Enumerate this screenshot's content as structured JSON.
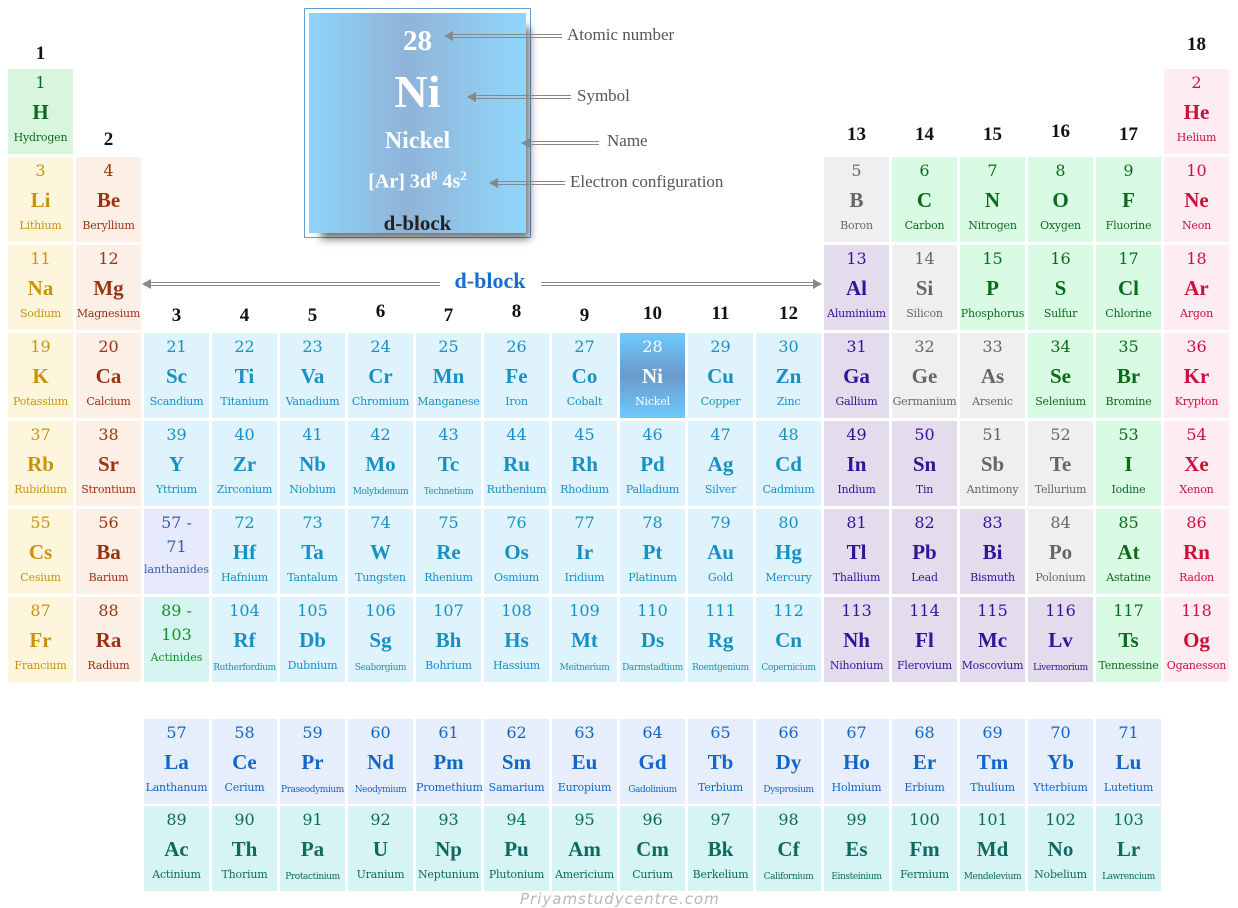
{
  "legend": {
    "atomic_number": "28",
    "symbol": "Ni",
    "name": "Nickel",
    "config_base": "[Ar] 3d",
    "config_sup1": "8",
    "config_mid": " 4s",
    "config_sup2": "2",
    "block": "d-block",
    "annotations": {
      "atomic_number": "Atomic number",
      "symbol": "Symbol",
      "name": "Name",
      "electron_configuration": "Electron configuration"
    }
  },
  "dblock_span_label": "d-block",
  "groups": [
    "1",
    "2",
    "3",
    "4",
    "5",
    "6",
    "7",
    "8",
    "9",
    "10",
    "11",
    "12",
    "13",
    "14",
    "15",
    "16",
    "17",
    "18"
  ],
  "highlighted_element": "Ni",
  "elements": [
    {
      "n": "1",
      "s": "H",
      "name": "Hydrogen",
      "col": 1,
      "row": 1,
      "cat": "nonmetal"
    },
    {
      "n": "2",
      "s": "He",
      "name": "Helium",
      "col": 18,
      "row": 1,
      "cat": "noble"
    },
    {
      "n": "3",
      "s": "Li",
      "name": "Lithium",
      "col": 1,
      "row": 2,
      "cat": "alkali"
    },
    {
      "n": "4",
      "s": "Be",
      "name": "Beryllium",
      "col": 2,
      "row": 2,
      "cat": "alkearth"
    },
    {
      "n": "5",
      "s": "B",
      "name": "Boron",
      "col": 13,
      "row": 2,
      "cat": "metalloid"
    },
    {
      "n": "6",
      "s": "C",
      "name": "Carbon",
      "col": 14,
      "row": 2,
      "cat": "nonmetal2"
    },
    {
      "n": "7",
      "s": "N",
      "name": "Nitrogen",
      "col": 15,
      "row": 2,
      "cat": "nonmetal2"
    },
    {
      "n": "8",
      "s": "O",
      "name": "Oxygen",
      "col": 16,
      "row": 2,
      "cat": "nonmetal2"
    },
    {
      "n": "9",
      "s": "F",
      "name": "Fluorine",
      "col": 17,
      "row": 2,
      "cat": "nonmetal2"
    },
    {
      "n": "10",
      "s": "Ne",
      "name": "Neon",
      "col": 18,
      "row": 2,
      "cat": "noble"
    },
    {
      "n": "11",
      "s": "Na",
      "name": "Sodium",
      "col": 1,
      "row": 3,
      "cat": "alkali"
    },
    {
      "n": "12",
      "s": "Mg",
      "name": "Magnesium",
      "col": 2,
      "row": 3,
      "cat": "alkearth"
    },
    {
      "n": "13",
      "s": "Al",
      "name": "Aluminium",
      "col": 13,
      "row": 3,
      "cat": "post"
    },
    {
      "n": "14",
      "s": "Si",
      "name": "Silicon",
      "col": 14,
      "row": 3,
      "cat": "metalloid"
    },
    {
      "n": "15",
      "s": "P",
      "name": "Phosphorus",
      "col": 15,
      "row": 3,
      "cat": "nonmetal2"
    },
    {
      "n": "16",
      "s": "S",
      "name": "Sulfur",
      "col": 16,
      "row": 3,
      "cat": "nonmetal2"
    },
    {
      "n": "17",
      "s": "Cl",
      "name": "Chlorine",
      "col": 17,
      "row": 3,
      "cat": "nonmetal2"
    },
    {
      "n": "18",
      "s": "Ar",
      "name": "Argon",
      "col": 18,
      "row": 3,
      "cat": "noble"
    },
    {
      "n": "19",
      "s": "K",
      "name": "Potassium",
      "col": 1,
      "row": 4,
      "cat": "alkali"
    },
    {
      "n": "20",
      "s": "Ca",
      "name": "Calcium",
      "col": 2,
      "row": 4,
      "cat": "alkearth"
    },
    {
      "n": "21",
      "s": "Sc",
      "name": "Scandium",
      "col": 3,
      "row": 4,
      "cat": "trans"
    },
    {
      "n": "22",
      "s": "Ti",
      "name": "Titanium",
      "col": 4,
      "row": 4,
      "cat": "trans"
    },
    {
      "n": "23",
      "s": "Va",
      "name": "Vanadium",
      "col": 5,
      "row": 4,
      "cat": "trans"
    },
    {
      "n": "24",
      "s": "Cr",
      "name": "Chromium",
      "col": 6,
      "row": 4,
      "cat": "trans"
    },
    {
      "n": "25",
      "s": "Mn",
      "name": "Manganese",
      "col": 7,
      "row": 4,
      "cat": "trans"
    },
    {
      "n": "26",
      "s": "Fe",
      "name": "Iron",
      "col": 8,
      "row": 4,
      "cat": "trans"
    },
    {
      "n": "27",
      "s": "Co",
      "name": "Cobalt",
      "col": 9,
      "row": 4,
      "cat": "trans"
    },
    {
      "n": "28",
      "s": "Ni",
      "name": "Nickel",
      "col": 10,
      "row": 4,
      "cat": "highlight"
    },
    {
      "n": "29",
      "s": "Cu",
      "name": "Copper",
      "col": 11,
      "row": 4,
      "cat": "trans"
    },
    {
      "n": "30",
      "s": "Zn",
      "name": "Zinc",
      "col": 12,
      "row": 4,
      "cat": "trans"
    },
    {
      "n": "31",
      "s": "Ga",
      "name": "Gallium",
      "col": 13,
      "row": 4,
      "cat": "post"
    },
    {
      "n": "32",
      "s": "Ge",
      "name": "Germanium",
      "col": 14,
      "row": 4,
      "cat": "metalloid"
    },
    {
      "n": "33",
      "s": "As",
      "name": "Arsenic",
      "col": 15,
      "row": 4,
      "cat": "metalloid"
    },
    {
      "n": "34",
      "s": "Se",
      "name": "Selenium",
      "col": 16,
      "row": 4,
      "cat": "nonmetal2"
    },
    {
      "n": "35",
      "s": "Br",
      "name": "Bromine",
      "col": 17,
      "row": 4,
      "cat": "nonmetal2"
    },
    {
      "n": "36",
      "s": "Kr",
      "name": "Krypton",
      "col": 18,
      "row": 4,
      "cat": "noble"
    },
    {
      "n": "37",
      "s": "Rb",
      "name": "Rubidium",
      "col": 1,
      "row": 5,
      "cat": "alkali"
    },
    {
      "n": "38",
      "s": "Sr",
      "name": "Strontium",
      "col": 2,
      "row": 5,
      "cat": "alkearth"
    },
    {
      "n": "39",
      "s": "Y",
      "name": "Yttrium",
      "col": 3,
      "row": 5,
      "cat": "trans"
    },
    {
      "n": "40",
      "s": "Zr",
      "name": "Zirconium",
      "col": 4,
      "row": 5,
      "cat": "trans"
    },
    {
      "n": "41",
      "s": "Nb",
      "name": "Niobium",
      "col": 5,
      "row": 5,
      "cat": "trans"
    },
    {
      "n": "42",
      "s": "Mo",
      "name": "Molybdenum",
      "col": 6,
      "row": 5,
      "cat": "trans",
      "small": true
    },
    {
      "n": "43",
      "s": "Tc",
      "name": "Technetium",
      "col": 7,
      "row": 5,
      "cat": "trans",
      "small": true
    },
    {
      "n": "44",
      "s": "Ru",
      "name": "Ruthenium",
      "col": 8,
      "row": 5,
      "cat": "trans"
    },
    {
      "n": "45",
      "s": "Rh",
      "name": "Rhodium",
      "col": 9,
      "row": 5,
      "cat": "trans"
    },
    {
      "n": "46",
      "s": "Pd",
      "name": "Palladium",
      "col": 10,
      "row": 5,
      "cat": "trans"
    },
    {
      "n": "47",
      "s": "Ag",
      "name": "Silver",
      "col": 11,
      "row": 5,
      "cat": "trans"
    },
    {
      "n": "48",
      "s": "Cd",
      "name": "Cadmium",
      "col": 12,
      "row": 5,
      "cat": "trans"
    },
    {
      "n": "49",
      "s": "In",
      "name": "Indium",
      "col": 13,
      "row": 5,
      "cat": "post"
    },
    {
      "n": "50",
      "s": "Sn",
      "name": "Tin",
      "col": 14,
      "row": 5,
      "cat": "post"
    },
    {
      "n": "51",
      "s": "Sb",
      "name": "Antimony",
      "col": 15,
      "row": 5,
      "cat": "metalloid"
    },
    {
      "n": "52",
      "s": "Te",
      "name": "Tellurium",
      "col": 16,
      "row": 5,
      "cat": "metalloid"
    },
    {
      "n": "53",
      "s": "I",
      "name": "Iodine",
      "col": 17,
      "row": 5,
      "cat": "nonmetal2"
    },
    {
      "n": "54",
      "s": "Xe",
      "name": "Xenon",
      "col": 18,
      "row": 5,
      "cat": "noble"
    },
    {
      "n": "55",
      "s": "Cs",
      "name": "Cesium",
      "col": 1,
      "row": 6,
      "cat": "alkali"
    },
    {
      "n": "56",
      "s": "Ba",
      "name": "Barium",
      "col": 2,
      "row": 6,
      "cat": "alkearth"
    },
    {
      "n": "72",
      "s": "Hf",
      "name": "Hafnium",
      "col": 4,
      "row": 6,
      "cat": "trans"
    },
    {
      "n": "73",
      "s": "Ta",
      "name": "Tantalum",
      "col": 5,
      "row": 6,
      "cat": "trans"
    },
    {
      "n": "74",
      "s": "W",
      "name": "Tungsten",
      "col": 6,
      "row": 6,
      "cat": "trans"
    },
    {
      "n": "75",
      "s": "Re",
      "name": "Rhenium",
      "col": 7,
      "row": 6,
      "cat": "trans"
    },
    {
      "n": "76",
      "s": "Os",
      "name": "Osmium",
      "col": 8,
      "row": 6,
      "cat": "trans"
    },
    {
      "n": "77",
      "s": "Ir",
      "name": "Iridium",
      "col": 9,
      "row": 6,
      "cat": "trans"
    },
    {
      "n": "78",
      "s": "Pt",
      "name": "Platinum",
      "col": 10,
      "row": 6,
      "cat": "trans"
    },
    {
      "n": "79",
      "s": "Au",
      "name": "Gold",
      "col": 11,
      "row": 6,
      "cat": "trans"
    },
    {
      "n": "80",
      "s": "Hg",
      "name": "Mercury",
      "col": 12,
      "row": 6,
      "cat": "trans"
    },
    {
      "n": "81",
      "s": "Tl",
      "name": "Thallium",
      "col": 13,
      "row": 6,
      "cat": "post"
    },
    {
      "n": "82",
      "s": "Pb",
      "name": "Lead",
      "col": 14,
      "row": 6,
      "cat": "post"
    },
    {
      "n": "83",
      "s": "Bi",
      "name": "Bismuth",
      "col": 15,
      "row": 6,
      "cat": "post"
    },
    {
      "n": "84",
      "s": "Po",
      "name": "Polonium",
      "col": 16,
      "row": 6,
      "cat": "metalloid"
    },
    {
      "n": "85",
      "s": "At",
      "name": "Astatine",
      "col": 17,
      "row": 6,
      "cat": "nonmetal2"
    },
    {
      "n": "86",
      "s": "Rn",
      "name": "Radon",
      "col": 18,
      "row": 6,
      "cat": "noble"
    },
    {
      "n": "87",
      "s": "Fr",
      "name": "Francium",
      "col": 1,
      "row": 7,
      "cat": "alkali"
    },
    {
      "n": "88",
      "s": "Ra",
      "name": "Radium",
      "col": 2,
      "row": 7,
      "cat": "alkearth"
    },
    {
      "n": "104",
      "s": "Rf",
      "name": "Rutherfordium",
      "col": 4,
      "row": 7,
      "cat": "trans",
      "small": true
    },
    {
      "n": "105",
      "s": "Db",
      "name": "Dubnium",
      "col": 5,
      "row": 7,
      "cat": "trans"
    },
    {
      "n": "106",
      "s": "Sg",
      "name": "Seaborgium",
      "col": 6,
      "row": 7,
      "cat": "trans",
      "small": true
    },
    {
      "n": "107",
      "s": "Bh",
      "name": "Bohrium",
      "col": 7,
      "row": 7,
      "cat": "trans"
    },
    {
      "n": "108",
      "s": "Hs",
      "name": "Hassium",
      "col": 8,
      "row": 7,
      "cat": "trans"
    },
    {
      "n": "109",
      "s": "Mt",
      "name": "Meitnerium",
      "col": 9,
      "row": 7,
      "cat": "trans",
      "small": true
    },
    {
      "n": "110",
      "s": "Ds",
      "name": "Darmstadtium",
      "col": 10,
      "row": 7,
      "cat": "trans",
      "small": true
    },
    {
      "n": "111",
      "s": "Rg",
      "name": "Roentgenium",
      "col": 11,
      "row": 7,
      "cat": "trans",
      "small": true
    },
    {
      "n": "112",
      "s": "Cn",
      "name": "Copernicium",
      "col": 12,
      "row": 7,
      "cat": "trans",
      "small": true
    },
    {
      "n": "113",
      "s": "Nh",
      "name": "Nihonium",
      "col": 13,
      "row": 7,
      "cat": "post"
    },
    {
      "n": "114",
      "s": "Fl",
      "name": "Flerovium",
      "col": 14,
      "row": 7,
      "cat": "post"
    },
    {
      "n": "115",
      "s": "Mc",
      "name": "Moscovium",
      "col": 15,
      "row": 7,
      "cat": "post"
    },
    {
      "n": "116",
      "s": "Lv",
      "name": "Livermorium",
      "col": 16,
      "row": 7,
      "cat": "post",
      "small": true
    },
    {
      "n": "117",
      "s": "Ts",
      "name": "Tennessine",
      "col": 17,
      "row": 7,
      "cat": "nonmetal2"
    },
    {
      "n": "118",
      "s": "Og",
      "name": "Oganesson",
      "col": 18,
      "row": 7,
      "cat": "noble"
    }
  ],
  "placeholders": [
    {
      "line1": "57 -",
      "line2": "71",
      "label": "lanthanides",
      "col": 3,
      "row": 6,
      "cat": "lanth-ph"
    },
    {
      "line1": "89 -",
      "line2": "103",
      "label": "Actinides",
      "col": 3,
      "row": 7,
      "cat": "actin-ph"
    }
  ],
  "lanthanides": [
    {
      "n": "57",
      "s": "La",
      "name": "Lanthanum"
    },
    {
      "n": "58",
      "s": "Ce",
      "name": "Cerium"
    },
    {
      "n": "59",
      "s": "Pr",
      "name": "Praseodymium",
      "small": true
    },
    {
      "n": "60",
      "s": "Nd",
      "name": "Neodymium",
      "small": true
    },
    {
      "n": "61",
      "s": "Pm",
      "name": "Promethium"
    },
    {
      "n": "62",
      "s": "Sm",
      "name": "Samarium"
    },
    {
      "n": "63",
      "s": "Eu",
      "name": "Europium"
    },
    {
      "n": "64",
      "s": "Gd",
      "name": "Gadolinium",
      "small": true
    },
    {
      "n": "65",
      "s": "Tb",
      "name": "Terbium"
    },
    {
      "n": "66",
      "s": "Dy",
      "name": "Dysprosium",
      "small": true
    },
    {
      "n": "67",
      "s": "Ho",
      "name": "Holmium"
    },
    {
      "n": "68",
      "s": "Er",
      "name": "Erbium"
    },
    {
      "n": "69",
      "s": "Tm",
      "name": "Thulium"
    },
    {
      "n": "70",
      "s": "Yb",
      "name": "Ytterbium"
    },
    {
      "n": "71",
      "s": "Lu",
      "name": "Lutetium"
    }
  ],
  "actinides": [
    {
      "n": "89",
      "s": "Ac",
      "name": "Actinium"
    },
    {
      "n": "90",
      "s": "Th",
      "name": "Thorium"
    },
    {
      "n": "91",
      "s": "Pa",
      "name": "Protactinium",
      "small": true
    },
    {
      "n": "92",
      "s": "U",
      "name": "Uranium"
    },
    {
      "n": "93",
      "s": "Np",
      "name": "Neptunium"
    },
    {
      "n": "94",
      "s": "Pu",
      "name": "Plutonium"
    },
    {
      "n": "95",
      "s": "Am",
      "name": "Americium"
    },
    {
      "n": "96",
      "s": "Cm",
      "name": "Curium"
    },
    {
      "n": "97",
      "s": "Bk",
      "name": "Berkelium"
    },
    {
      "n": "98",
      "s": "Cf",
      "name": "Californium",
      "small": true
    },
    {
      "n": "99",
      "s": "Es",
      "name": "Einsteinium",
      "small": true
    },
    {
      "n": "100",
      "s": "Fm",
      "name": "Fermium"
    },
    {
      "n": "101",
      "s": "Md",
      "name": "Mendelevium",
      "small": true
    },
    {
      "n": "102",
      "s": "No",
      "name": "Nobelium"
    },
    {
      "n": "103",
      "s": "Lr",
      "name": "Lawrencium",
      "small": true
    }
  ],
  "watermark": "Priyamstudycentre.com"
}
